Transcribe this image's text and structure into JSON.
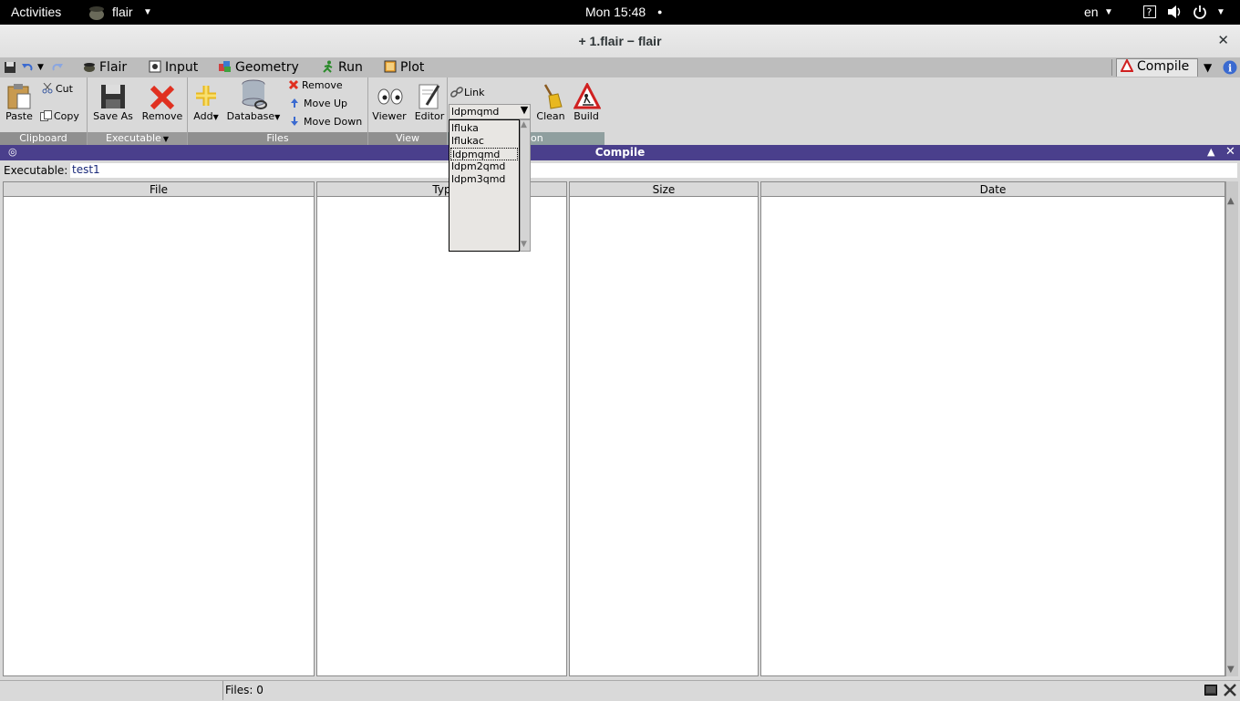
{
  "topbar": {
    "activities": "Activities",
    "app_menu": "flair",
    "clock": "Mon 15:48",
    "lang": "en"
  },
  "window": {
    "title": "+ 1.flair − flair",
    "close": "✕"
  },
  "tabs": {
    "flair": "Flair",
    "input": "Input",
    "geometry": "Geometry",
    "run": "Run",
    "plot": "Plot",
    "compile": "Compile"
  },
  "ribbon": {
    "clipboard": {
      "label": "Clipboard",
      "paste": "Paste",
      "cut": "Cut",
      "copy": "Copy"
    },
    "executable": {
      "label": "Executable",
      "save_as": "Save As",
      "remove": "Remove"
    },
    "files": {
      "label": "Files",
      "add": "Add",
      "database": "Database",
      "remove": "Remove",
      "move_up": "Move Up",
      "move_down": "Move Down"
    },
    "view": {
      "label": "View",
      "viewer": "Viewer",
      "editor": "Editor"
    },
    "compilation": {
      "label_visible": "on",
      "link": "Link",
      "link_value": "ldpmqmd",
      "clean": "Clean",
      "build": "Build"
    }
  },
  "dropdown": {
    "options": [
      "lfluka",
      "lflukac",
      "ldpmqmd",
      "ldpm2qmd",
      "ldpm3qmd"
    ],
    "selected_index": 2
  },
  "frame": {
    "title": "Compile",
    "executable_label": "Executable:",
    "executable_value": "test1"
  },
  "table": {
    "columns": [
      "File",
      "Typ",
      "Size",
      "Date"
    ]
  },
  "status": {
    "files": "Files: 0"
  }
}
